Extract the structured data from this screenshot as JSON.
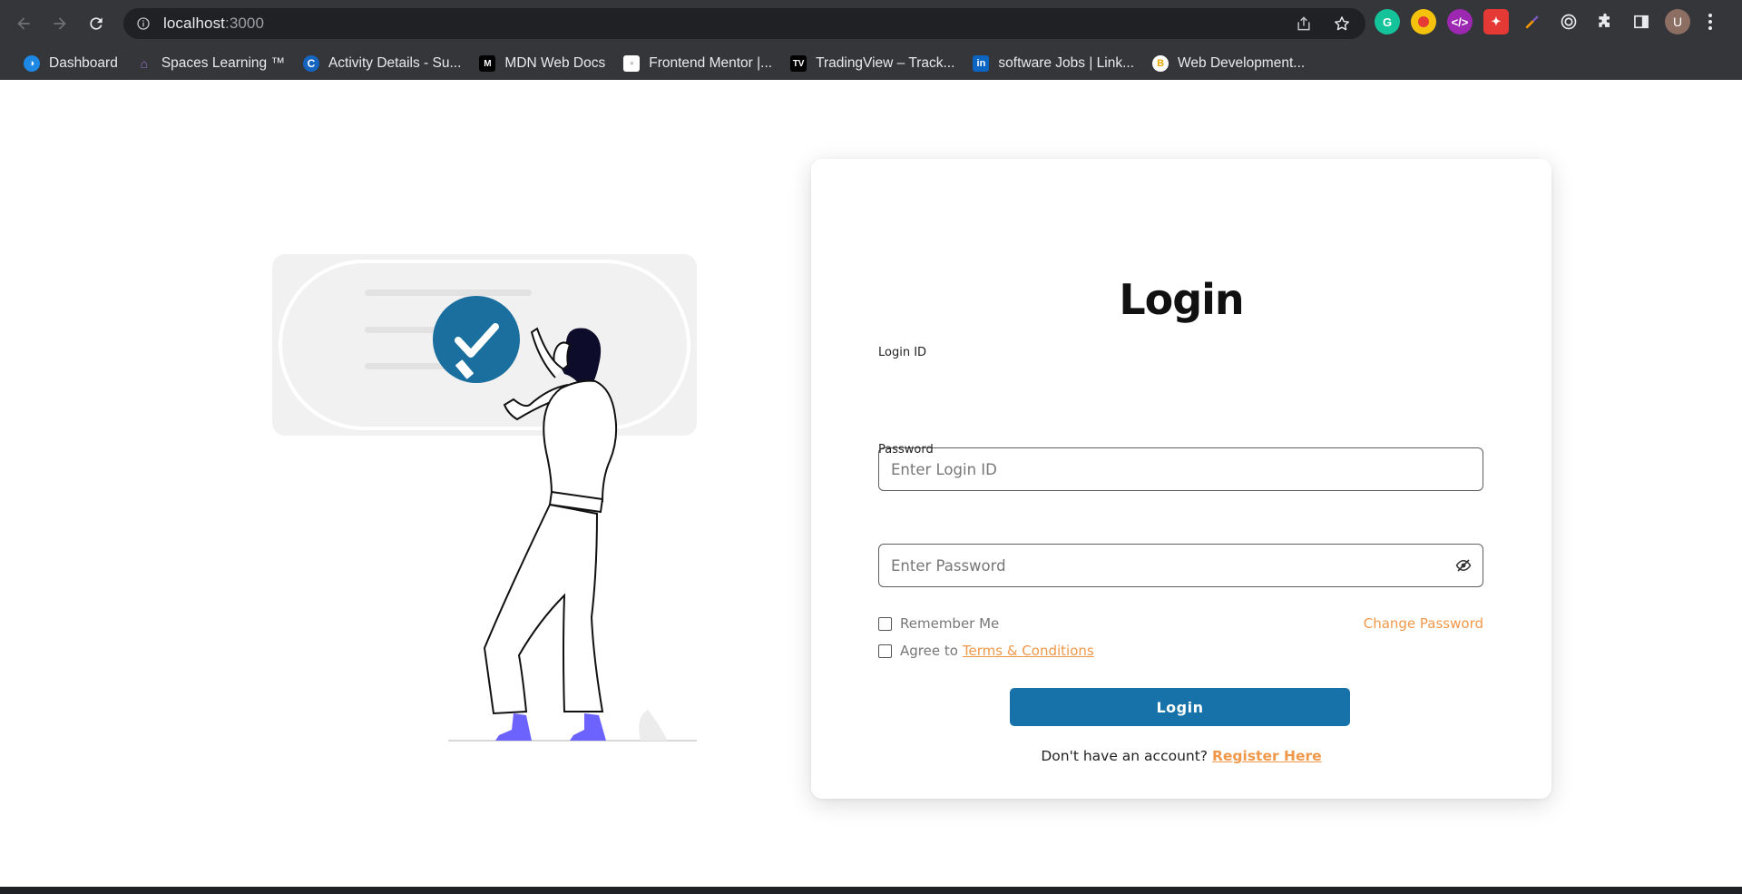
{
  "browser": {
    "url_host": "localhost",
    "url_port": ":3000",
    "avatar_letter": "U",
    "bookmarks": [
      {
        "label": "Dashboard",
        "icon": "dashboard-favicon",
        "color": "#1e88e5"
      },
      {
        "label": "Spaces Learning ™",
        "icon": "spaces-favicon",
        "color": "#7e57c2"
      },
      {
        "label": "Activity Details - Su...",
        "icon": "c-favicon",
        "color": "#1565c0"
      },
      {
        "label": "MDN Web Docs",
        "icon": "mdn-favicon",
        "color": "#000000"
      },
      {
        "label": "Frontend Mentor |...",
        "icon": "frontend-mentor-favicon",
        "color": "#ffffff"
      },
      {
        "label": "TradingView – Track...",
        "icon": "tradingview-favicon",
        "color": "#000000"
      },
      {
        "label": "software Jobs | Link...",
        "icon": "linkedin-favicon",
        "color": "#0a66c2"
      },
      {
        "label": "Web Development...",
        "icon": "web-dev-favicon",
        "color": "#ffffff"
      }
    ],
    "colors": {
      "chrome": "#35363a",
      "omnibox": "#202124"
    }
  },
  "login": {
    "title": "Login",
    "login_id_label": "Login ID",
    "login_id_placeholder": "Enter Login ID",
    "password_label": "Password",
    "password_placeholder": "Enter Password",
    "remember_me": "Remember Me",
    "change_password": "Change Password",
    "agree_prefix": "Agree to",
    "terms_link": "Terms & Conditions",
    "login_button": "Login",
    "register_prefix": "Don't have an account?",
    "register_link": "Register Here",
    "colors": {
      "primary": "#1672a8",
      "accent": "#f0984a"
    }
  }
}
